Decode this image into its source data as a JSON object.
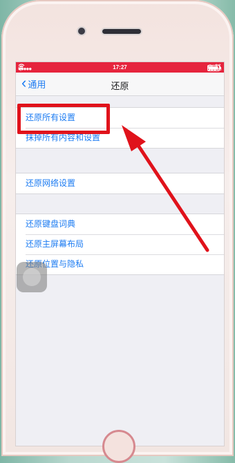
{
  "status": {
    "carrier": "中国联通",
    "time": "17:27",
    "battery": "100%"
  },
  "nav": {
    "back_label": "通用",
    "title": "还原"
  },
  "groups": [
    {
      "items": [
        "还原所有设置",
        "抹掉所有内容和设置"
      ]
    },
    {
      "items": [
        "还原网络设置"
      ]
    },
    {
      "items": [
        "还原键盘词典",
        "还原主屏幕布局",
        "还原位置与隐私"
      ]
    }
  ],
  "colors": {
    "accent": "#1d7cf2",
    "annotation": "#e0121b",
    "statusbar": "#e6243d"
  },
  "icons": [
    "signal-icon",
    "wifi-icon",
    "lock-icon",
    "alarm-icon",
    "battery-icon",
    "chevron-left-icon"
  ]
}
